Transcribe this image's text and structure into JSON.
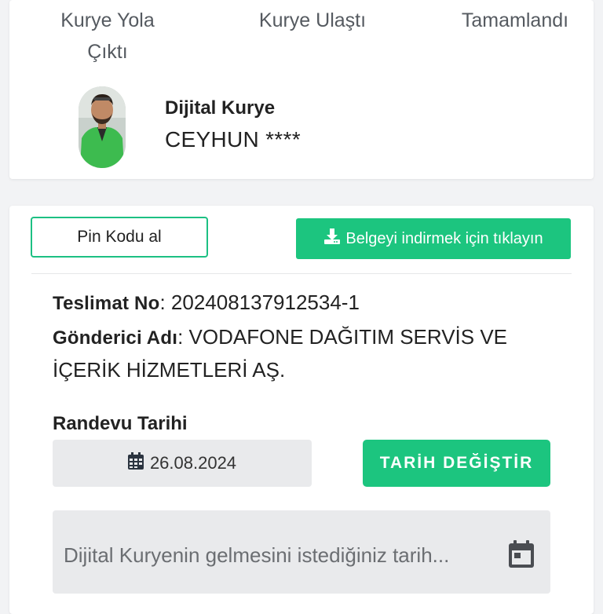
{
  "status_steps": {
    "step1": "Kurye Yola Çıktı",
    "step2": "Kurye Ulaştı",
    "step3": "Tamamlandı"
  },
  "courier": {
    "title": "Dijital Kurye",
    "name": "CEYHUN ****"
  },
  "actions": {
    "pin_button": "Pin Kodu al",
    "download_button": "Belgeyi indirmek için tıklayın",
    "download_icon": "download-icon"
  },
  "delivery": {
    "number_label": "Teslimat No",
    "number_value": "202408137912534-1",
    "sender_label": "Gönderici Adı",
    "sender_value": "VODAFONE DAĞITIM SERVİS VE İÇERİK HİZMETLERİ AŞ."
  },
  "appointment": {
    "label": "Randevu Tarihi",
    "date": "26.08.2024",
    "change_button": "TARİH DEĞİŞTİR",
    "date_picker_placeholder": "Dijital Kuryenin gelmesini istediğiniz tarih..."
  },
  "colors": {
    "accent_green": "#1cc57f",
    "page_bg": "#f2f3f5",
    "field_bg": "#e9eaec"
  }
}
